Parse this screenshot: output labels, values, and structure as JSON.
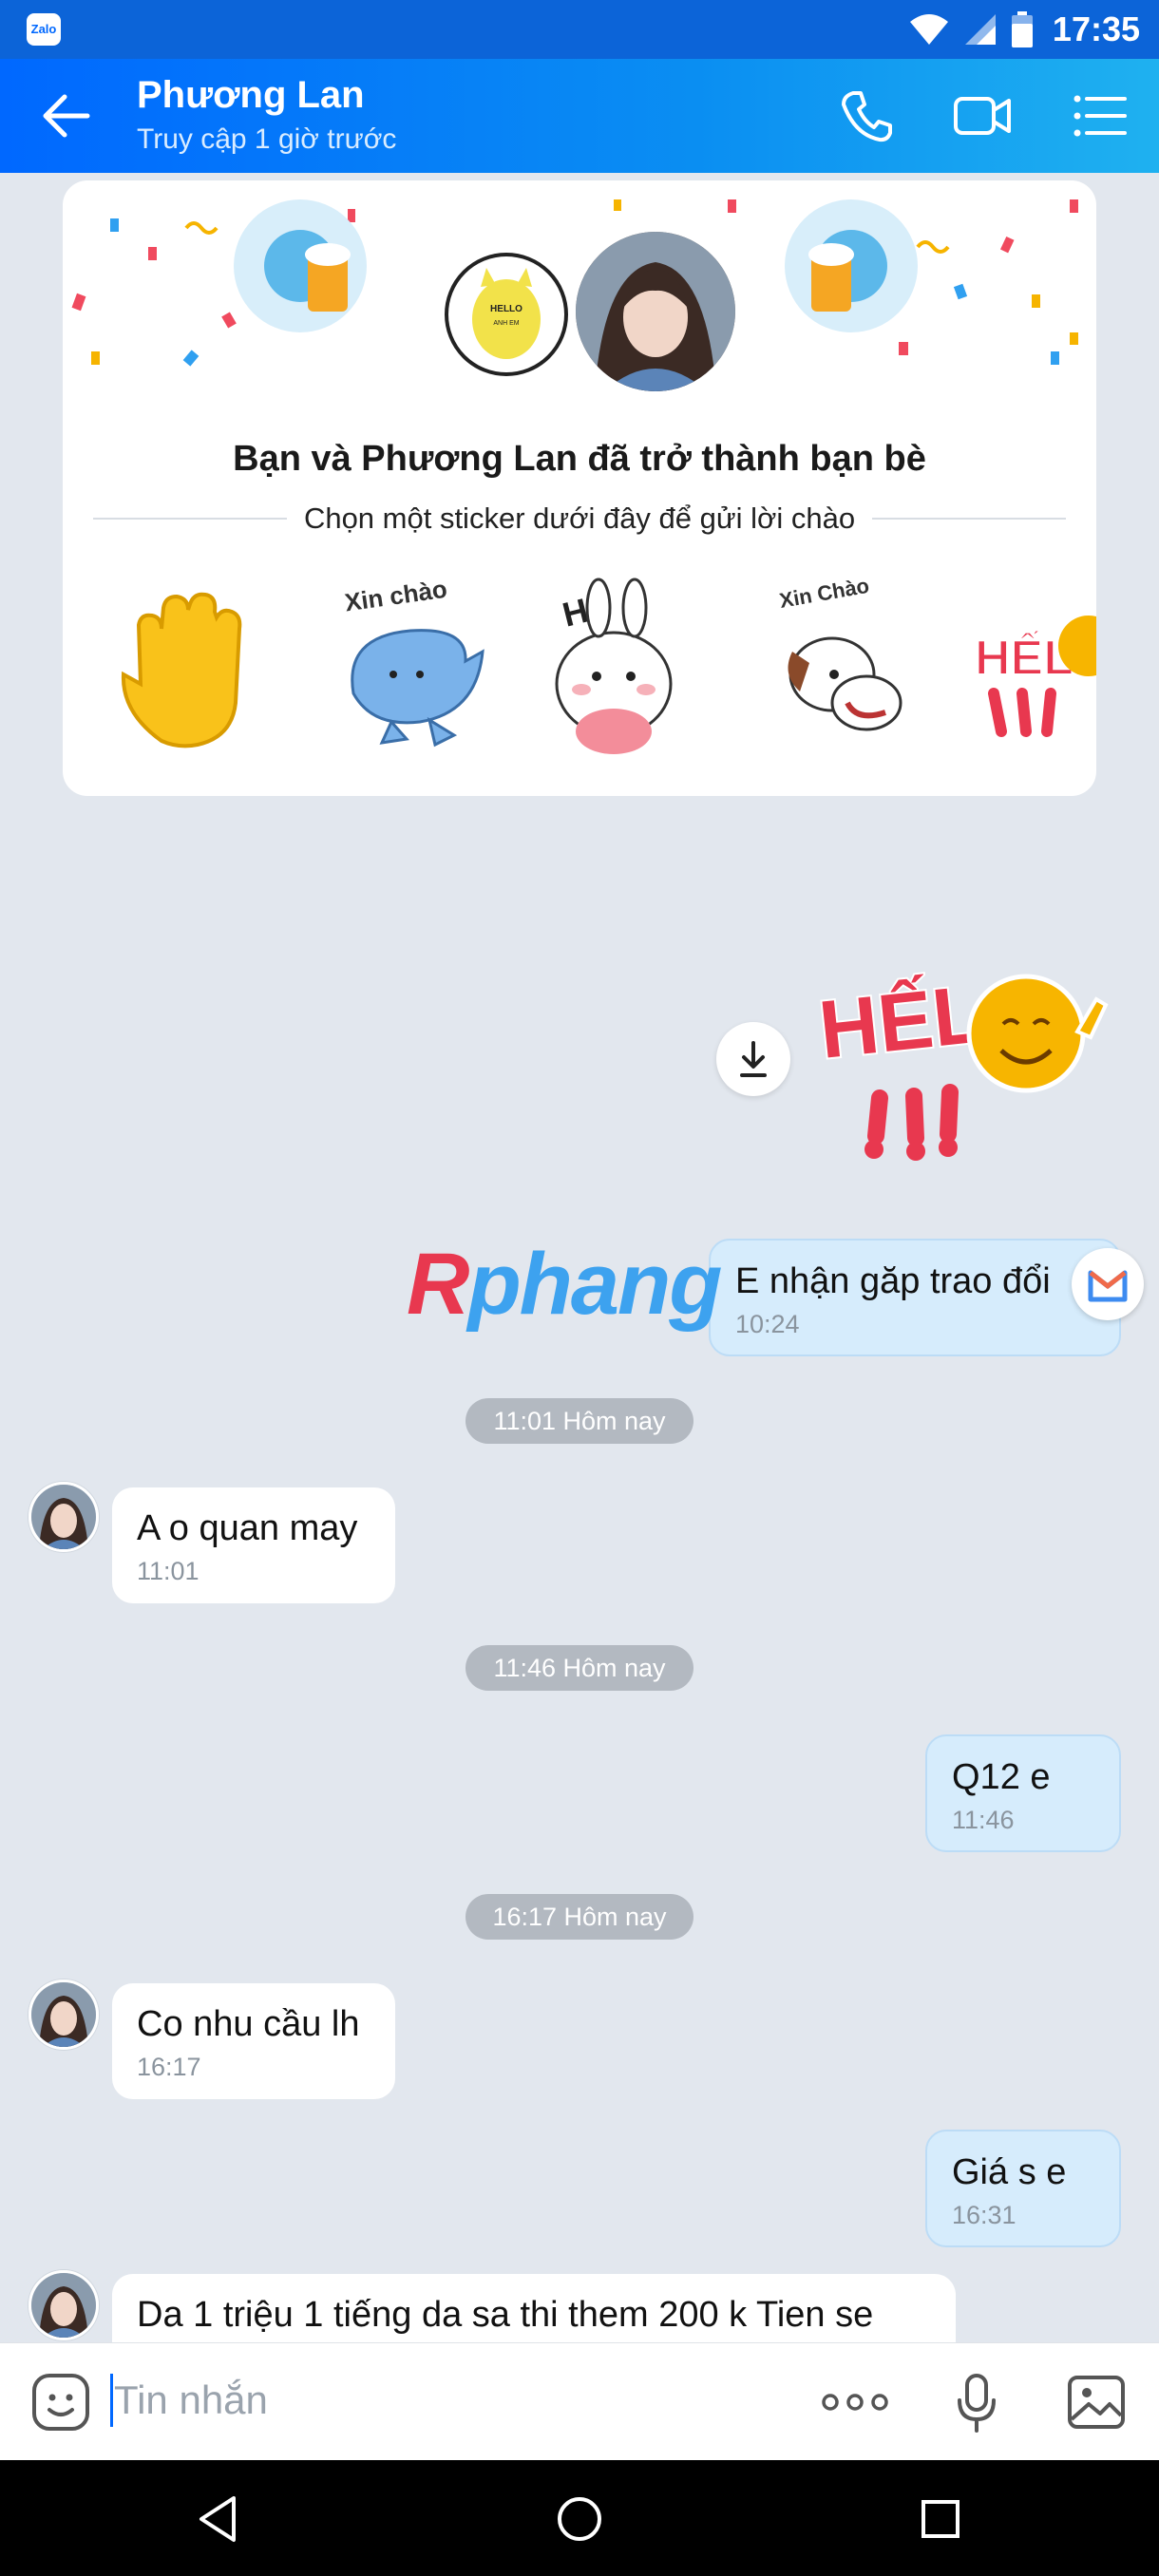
{
  "status_bar": {
    "app_badge": "Zalo",
    "time": "17:35"
  },
  "header": {
    "title": "Phương Lan",
    "subtitle": "Truy cập 1 giờ trước"
  },
  "friend_card": {
    "title": "Bạn và Phương Lan đã trở thành bạn bè",
    "prompt": "Chọn một sticker dưới đây để gửi lời chào",
    "my_avatar_text": "HELLO",
    "my_avatar_subtext": "ANH EM",
    "sticker_texts": [
      "Xin chào",
      "HI!",
      "Xin Chào",
      "HẾL"
    ]
  },
  "big_sticker_text": "HẾL",
  "watermark": {
    "first": "R",
    "rest": "phang"
  },
  "messages": [
    {
      "side": "me",
      "text": "E nhận găp trao đổi",
      "time": "10:24"
    },
    {
      "side": "them",
      "text": "A o quan may",
      "time": "11:01"
    },
    {
      "side": "me",
      "text": "Q12 e",
      "time": "11:46"
    },
    {
      "side": "them",
      "text": "Co nhu cầu lh",
      "time": "16:17"
    },
    {
      "side": "me",
      "text": "Giá s e",
      "time": "16:31"
    },
    {
      "side": "them",
      "text": "Da 1 triệu 1 tiếng da  sa thi them 200 k Tien se",
      "time": ""
    }
  ],
  "time_dividers": [
    "11:01 Hôm nay",
    "11:46 Hôm nay",
    "16:17 Hôm nay"
  ],
  "composer": {
    "placeholder": "Tin nhắn"
  },
  "colors": {
    "accent": "#0068ff",
    "my_bubble": "#d6ecfc",
    "chat_background": "#e2e7ee"
  }
}
